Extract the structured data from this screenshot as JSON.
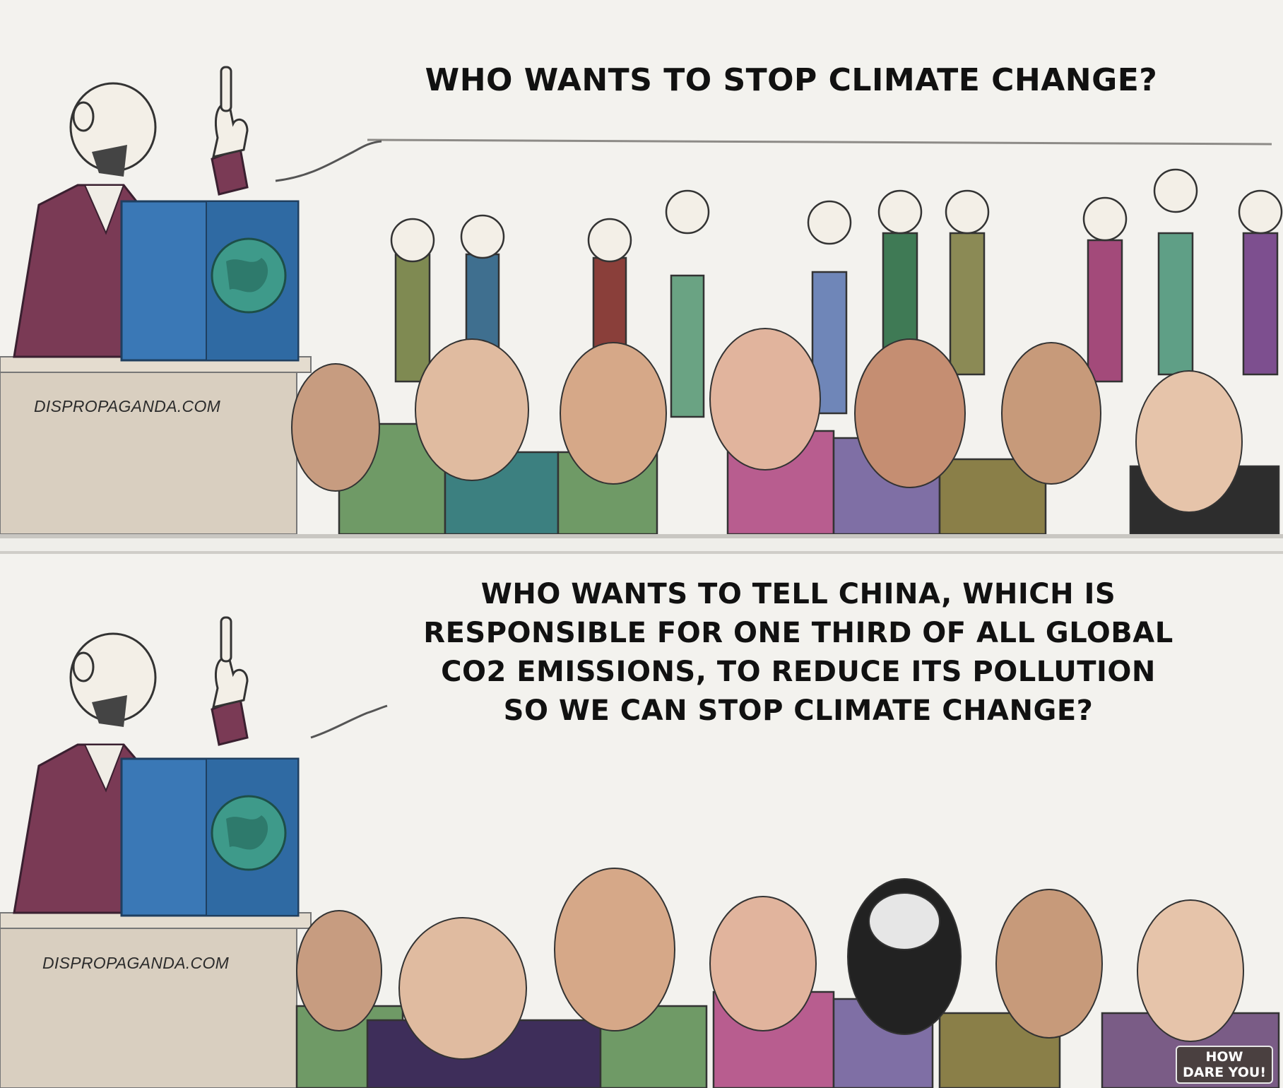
{
  "panels": [
    {
      "caption": "WHO WANTS TO STOP CLIMATE CHANGE?",
      "watermark": "DISPROPAGANDA.COM"
    },
    {
      "caption_lines": [
        "WHO WANTS TO TELL CHINA, WHICH IS",
        "RESPONSIBLE FOR ONE THIRD OF ALL GLOBAL",
        "CO2 EMISSIONS, TO REDUCE ITS POLLUTION",
        "SO WE CAN STOP CLIMATE CHANGE?"
      ],
      "watermark": "DISPROPAGANDA.COM",
      "badge_lines": [
        "HOW",
        "DARE YOU!"
      ]
    }
  ],
  "colors": {
    "background": "#f3f2ee",
    "podium": "#3a78b6",
    "podium_dark": "#2f5f8f",
    "speaker_suit": "#7a3a55",
    "globe": "#3e9a8a"
  }
}
